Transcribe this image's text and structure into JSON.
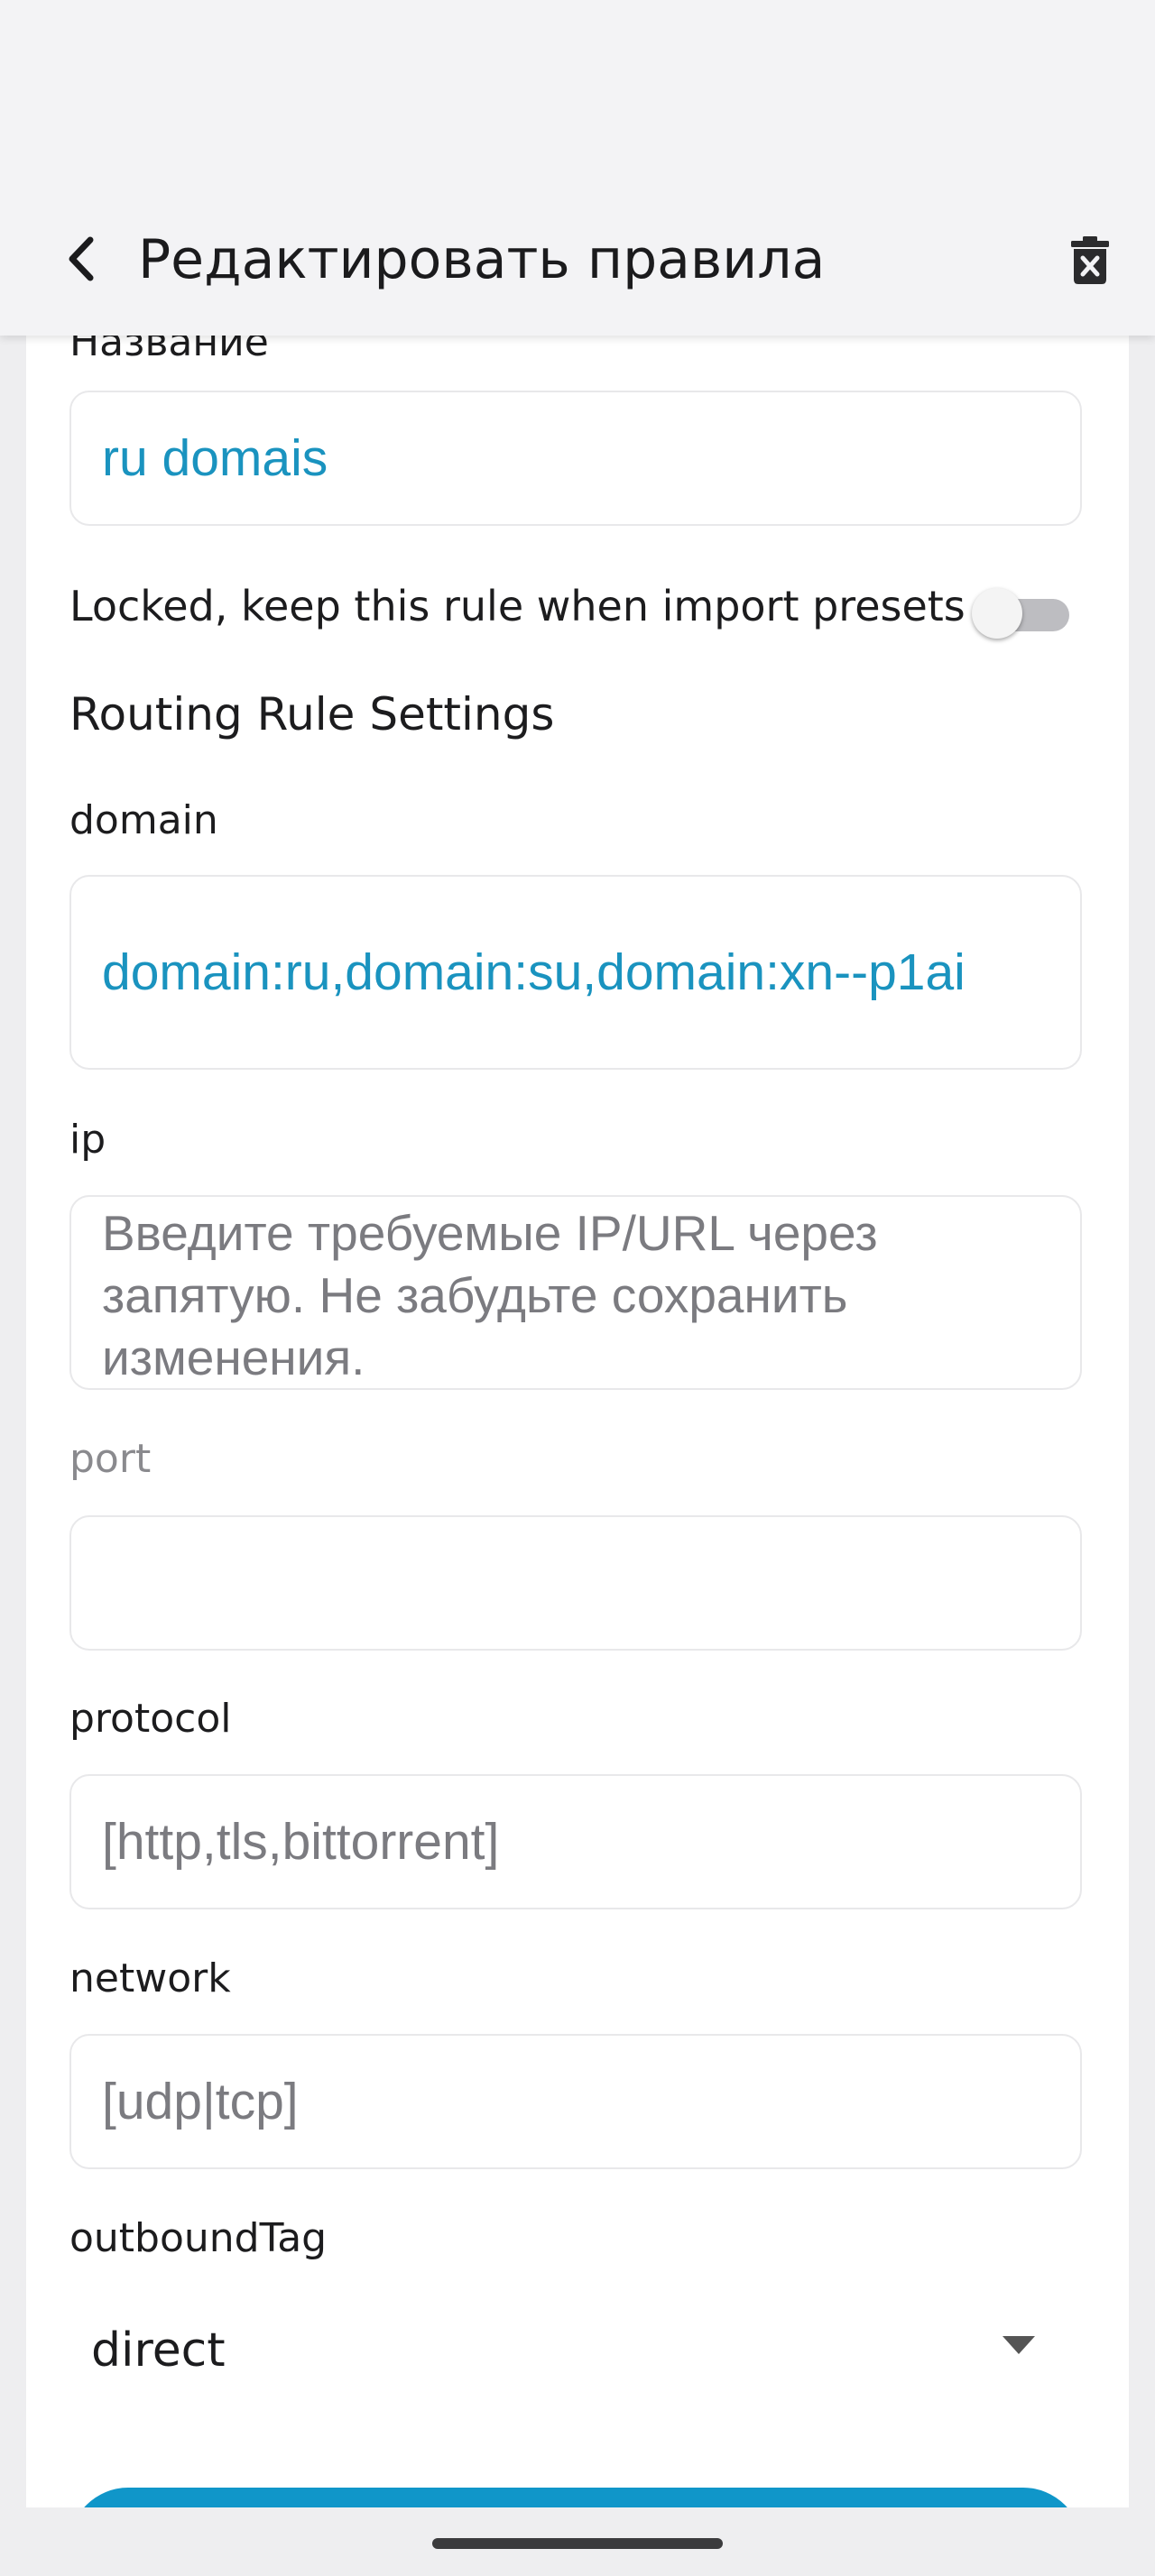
{
  "header": {
    "title": "Редактировать правила"
  },
  "form": {
    "name_label": "Название",
    "name_value": "ru domais",
    "locked_label": "Locked, keep this rule when import presets",
    "locked_on": false,
    "section_title": "Routing Rule Settings",
    "domain_label": "domain",
    "domain_value": "domain:ru,domain:su,domain:xn--p1ai",
    "ip_label": "ip",
    "ip_placeholder": "Введите требуемые IP/URL через запятую. Не забудьте сохранить изменения.",
    "port_label": "port",
    "port_value": "",
    "protocol_label": "protocol",
    "protocol_placeholder": "[http,tls,bittorrent]",
    "network_label": "network",
    "network_placeholder": "[udp|tcp]",
    "outbound_label": "outboundTag",
    "outbound_value": "direct"
  },
  "colors": {
    "accent": "#1096c9",
    "value_text": "#1a93bf",
    "background": "#eeeef0"
  },
  "icons": {
    "back": "chevron-left-icon",
    "delete": "trash-x-icon",
    "dropdown": "caret-down-icon"
  }
}
